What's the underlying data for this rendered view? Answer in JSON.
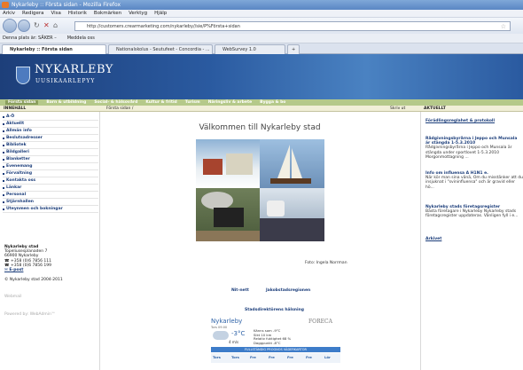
{
  "window": {
    "title": "Nykarleby :: Första sidan - Mozilla Firefox"
  },
  "menu": [
    "Arkiv",
    "Redigera",
    "Visa",
    "Historik",
    "Bokmärken",
    "Verktyg",
    "Hjälp"
  ],
  "address": {
    "url": "http://customers.crearmarketing.com/nykarleby//sie/P%Första+sidan"
  },
  "bookmarks": [
    "Denna plats är: SÄKER –",
    "Meddela oss"
  ],
  "tabs": [
    {
      "label": "Nykarleby :: Första sidan"
    },
    {
      "label": "Nationalskolus - Seutufeet - Concordia - ..."
    },
    {
      "label": "WebSurvey 1.0"
    }
  ],
  "site": {
    "name": "NYKARLEBY",
    "subname": "UUSIKAARLEPYY",
    "nav": [
      "Första sidan",
      "Barn & utbildning",
      "Social- & hälsovård",
      "Kultur & fritid",
      "Turism",
      "Näringsliv & arbete",
      "Bygga & bo"
    ],
    "col_left": "INNEHÅLL",
    "col_mid": "Första sidan /",
    "col_print": "Skriv ut",
    "col_right": "AKTUELLT",
    "left_items": [
      "A-Ö",
      "Aktuellt",
      "Allmän info",
      "Beslutsadresser",
      "Bibliotek",
      "Bildgalleri",
      "Blanketter",
      "Evenemang",
      "Förvaltning",
      "Kontakta oss",
      "Länkar",
      "Personal",
      "Stjärnhallen",
      "Uteynmen och bokningar"
    ],
    "address_lines": [
      "Nykarleby stad",
      "Topeliusesplanaden 7",
      "66900 Nykarleby",
      "☎ +358 (0)6 7856 111",
      "☎ +358 (0)6 7856 199",
      "✉ E-post"
    ],
    "copyright": "© Nykarleby stad 2004-2011",
    "webmail": "Webmail",
    "powered": "Powered by: WebAdmin™",
    "welcome": "Välkommen till Nykarleby stad",
    "photo_caption": "Foto: Ingela Norrman",
    "links": [
      "Nit-nett",
      "Jakobstadsregionen"
    ],
    "link2": "Stadsdirektörens hälsning",
    "weather": {
      "city": "Nykarleby",
      "time": "Tors 09:00",
      "brand": "FORECA",
      "temp": "-3°C",
      "wind": "4 m/s",
      "details": [
        "Känns som -9°C",
        "Sikt 10 km",
        "Relativ fuktighet 68 %",
        "Daggpunkt -8°C"
      ],
      "bar": "FULLSTÄNDIG PROGNOS   VÄDERKARTOR",
      "days": [
        "Tors",
        "Tors",
        "Fre",
        "Fre",
        "Fre",
        "Fre",
        "Lör"
      ]
    },
    "news": [
      {
        "title": "Förädlingsreglahet & protokoll",
        "body": ""
      },
      {
        "title": "Rådgivningsbyrårna i Jeppo och Munsala är stängda 1-5.3.2010",
        "body": "Rådgivningsbyrårna i Jeppo och Munsala är stängda under sportlovet 1-5.3.2010 Morgonmottagning ..."
      },
      {
        "title": "Info om influensa A H1N1 e.",
        "body": "När kör man sina vänä, Om du misstänker att du insjuknat i \"svininfluensa\" och är gravid eller hö..."
      },
      {
        "title": "Nykarleby stads företagsregister",
        "body": "Bästa företagare i Nykarleby Nykarleby stads företagsregister uppdateras. Vänligen fyll i e..."
      },
      {
        "title": "Arkivet",
        "body": ""
      }
    ]
  }
}
